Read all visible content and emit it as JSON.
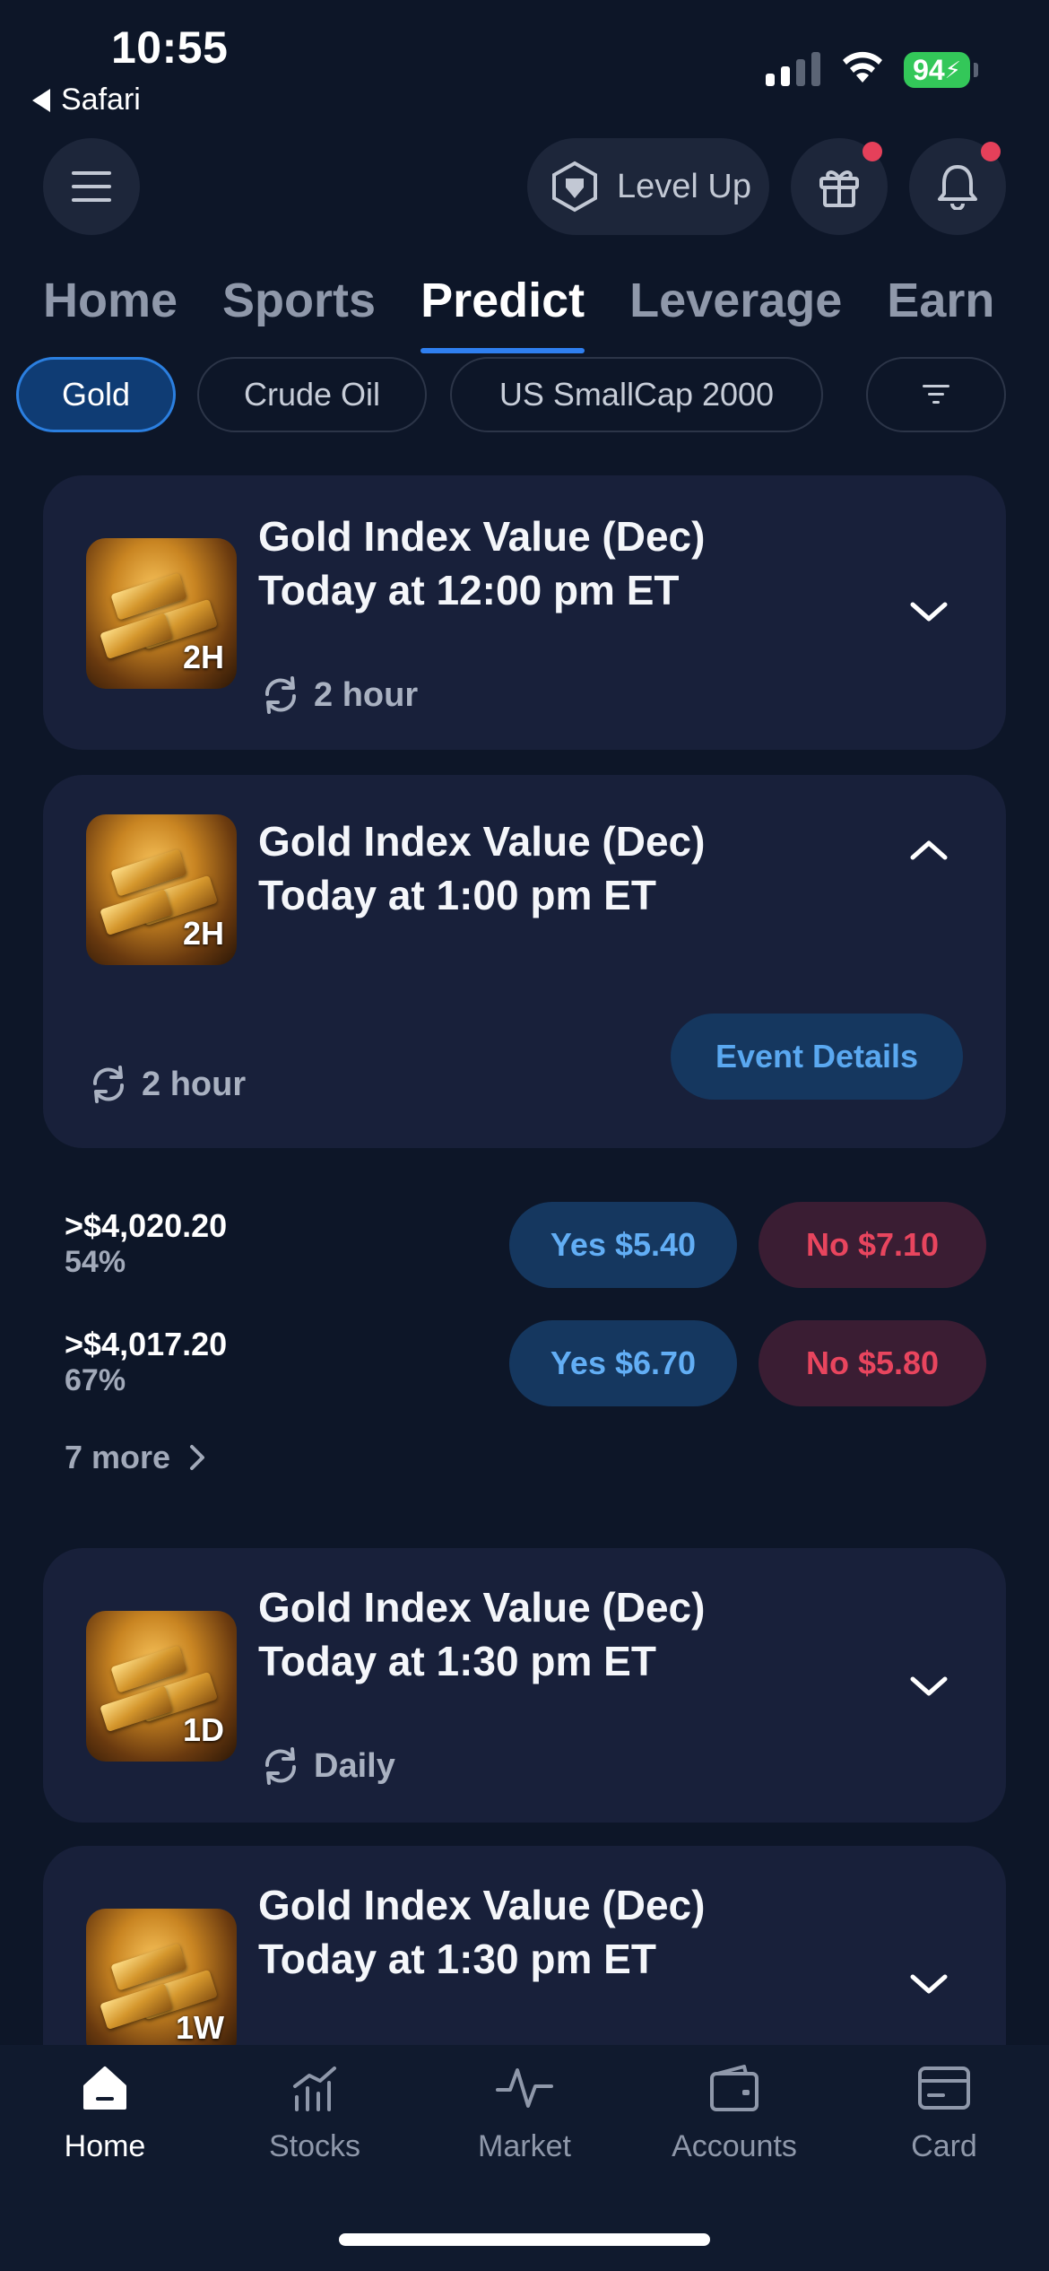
{
  "status_bar": {
    "time": "10:55",
    "back_app": "Safari",
    "battery": "94"
  },
  "header": {
    "menu_icon": "hamburger-menu-icon",
    "level_up_label": "Level Up",
    "gift_icon": "gift-icon",
    "bell_icon": "bell-icon"
  },
  "tabs": [
    {
      "label": "Home",
      "active": false
    },
    {
      "label": "Sports",
      "active": false
    },
    {
      "label": "Predict",
      "active": true
    },
    {
      "label": "Leverage",
      "active": false
    },
    {
      "label": "Earn",
      "active": false
    }
  ],
  "chips": [
    {
      "label": "Gold",
      "selected": true
    },
    {
      "label": "Crude Oil",
      "selected": false
    },
    {
      "label": "US SmallCap 2000",
      "selected": false
    }
  ],
  "cards": [
    {
      "title": "Gold Index Value (Dec)",
      "subtitle": "Today at 12:00 pm ET",
      "badge": "2H",
      "frequency": "2 hour",
      "expanded": false
    },
    {
      "title": "Gold Index Value (Dec)",
      "subtitle": "Today at 1:00 pm ET",
      "badge": "2H",
      "frequency": "2 hour",
      "expanded": true,
      "event_details_label": "Event Details"
    },
    {
      "title": "Gold Index Value (Dec)",
      "subtitle": "Today at 1:30 pm ET",
      "badge": "1D",
      "frequency": "Daily",
      "expanded": false
    },
    {
      "title": "Gold Index Value (Dec)",
      "subtitle": "Today at 1:30 pm ET",
      "badge": "1W",
      "expanded": false
    }
  ],
  "outcomes": [
    {
      "value": ">$4,020.20",
      "percent": "54%",
      "yes": "Yes $5.40",
      "no": "No $7.10"
    },
    {
      "value": ">$4,017.20",
      "percent": "67%",
      "yes": "Yes $6.70",
      "no": "No $5.80"
    }
  ],
  "more_label": "7 more",
  "bottom_nav": [
    {
      "label": "Home",
      "icon": "home-icon",
      "active": true
    },
    {
      "label": "Stocks",
      "icon": "stocks-chart-icon",
      "active": false
    },
    {
      "label": "Market",
      "icon": "pulse-icon",
      "active": false
    },
    {
      "label": "Accounts",
      "icon": "wallet-icon",
      "active": false
    },
    {
      "label": "Card",
      "icon": "credit-card-icon",
      "active": false
    }
  ],
  "colors": {
    "background": "#0d1628",
    "card": "#18203a",
    "accent": "#2f7ff0",
    "yes": "#62aef5",
    "no": "#e8455e"
  }
}
